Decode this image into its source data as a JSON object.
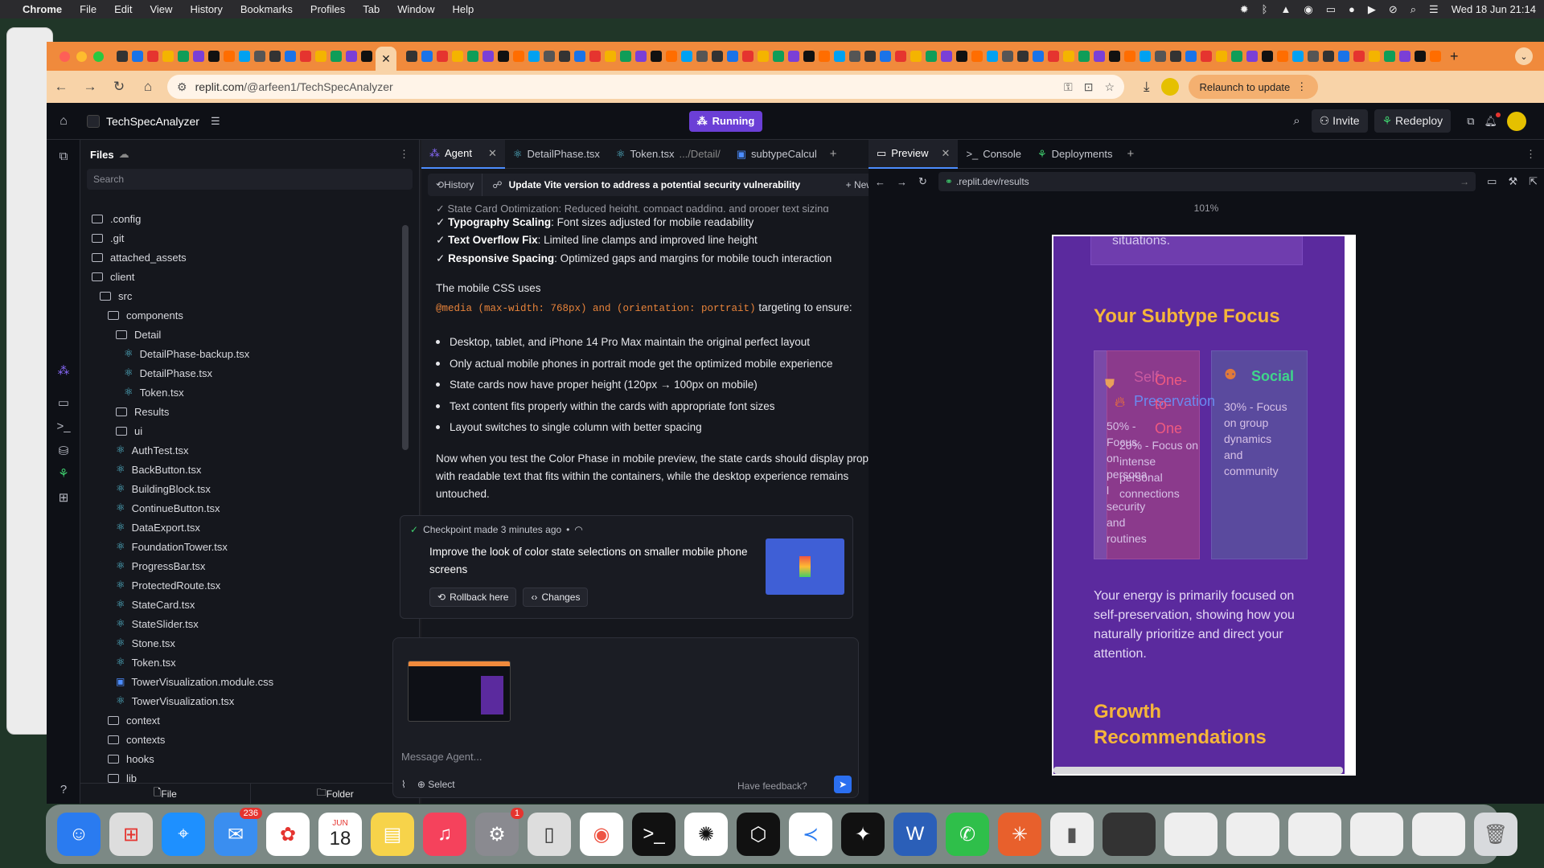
{
  "menubar": {
    "app": "Chrome",
    "items": [
      "File",
      "Edit",
      "View",
      "History",
      "Bookmarks",
      "Profiles",
      "Tab",
      "Window",
      "Help"
    ],
    "datetime": "Wed 18 Jun  21:14"
  },
  "browser": {
    "url_host": "replit.com",
    "url_path": "/@arfeen1/TechSpecAnalyzer",
    "relaunch_label": "Relaunch to update",
    "new_tab": "+"
  },
  "replit": {
    "project_name": "TechSpecAnalyzer",
    "run_status": "Running",
    "invite_label": "Invite",
    "redeploy_label": "Redeploy"
  },
  "files_panel": {
    "title": "Files",
    "search_placeholder": "Search",
    "items": [
      {
        "name": ".config",
        "type": "folder"
      },
      {
        "name": ".git",
        "type": "folder"
      },
      {
        "name": "attached_assets",
        "type": "folder"
      },
      {
        "name": "client",
        "type": "folder"
      },
      {
        "name": "src",
        "type": "folder"
      },
      {
        "name": "components",
        "type": "folder"
      },
      {
        "name": "Detail",
        "type": "folder"
      },
      {
        "name": "DetailPhase-backup.tsx",
        "type": "react"
      },
      {
        "name": "DetailPhase.tsx",
        "type": "react"
      },
      {
        "name": "Token.tsx",
        "type": "react"
      },
      {
        "name": "Results",
        "type": "folder"
      },
      {
        "name": "ui",
        "type": "folder"
      },
      {
        "name": "AuthTest.tsx",
        "type": "react"
      },
      {
        "name": "BackButton.tsx",
        "type": "react"
      },
      {
        "name": "BuildingBlock.tsx",
        "type": "react"
      },
      {
        "name": "ContinueButton.tsx",
        "type": "react"
      },
      {
        "name": "DataExport.tsx",
        "type": "react"
      },
      {
        "name": "FoundationTower.tsx",
        "type": "react"
      },
      {
        "name": "ProgressBar.tsx",
        "type": "react"
      },
      {
        "name": "ProtectedRoute.tsx",
        "type": "react"
      },
      {
        "name": "StateCard.tsx",
        "type": "react"
      },
      {
        "name": "StateSlider.tsx",
        "type": "react"
      },
      {
        "name": "Stone.tsx",
        "type": "react"
      },
      {
        "name": "Token.tsx",
        "type": "react"
      },
      {
        "name": "TowerVisualization.module.css",
        "type": "css"
      },
      {
        "name": "TowerVisualization.tsx",
        "type": "react"
      },
      {
        "name": "context",
        "type": "folder"
      },
      {
        "name": "contexts",
        "type": "folder"
      },
      {
        "name": "hooks",
        "type": "folder"
      },
      {
        "name": "lib",
        "type": "folder"
      }
    ],
    "new_file_label": "File",
    "new_folder_label": "Folder"
  },
  "agent": {
    "tabs": [
      {
        "label": "Agent"
      },
      {
        "label": "DetailPhase.tsx"
      },
      {
        "label": "Token.tsx",
        "extra": ".../Detail/"
      },
      {
        "label": "subtypeCalcul"
      }
    ],
    "history_label": "History",
    "thread_title": "Update Vite version to address a potential security vulnerability",
    "new_chat_label": "New chat",
    "cut_line": "✓ State Card Optimization: Reduced height, compact padding, and proper text sizing",
    "checks": [
      {
        "bold": "Typography Scaling",
        "text": ": Font sizes adjusted for mobile readability"
      },
      {
        "bold": "Text Overflow Fix",
        "text": ": Limited line clamps and improved line height"
      },
      {
        "bold": "Responsive Spacing",
        "text": ": Optimized gaps and margins for mobile touch interaction"
      }
    ],
    "css_intro": "The mobile CSS uses",
    "css_code": "@media (max-width: 768px) and (orientation: portrait)",
    "css_outro": "targeting to ensure:",
    "bullets": [
      "Desktop, tablet, and iPhone 14 Pro Max maintain the original perfect layout",
      "Only actual mobile phones in portrait mode get the optimized mobile experience",
      "State cards now have proper height (120px → 100px on mobile)",
      "Text content fits properly within the cards with appropriate font sizes",
      "Layout switches to single column with better spacing"
    ],
    "summary": "Now when you test the Color Phase in mobile preview, the state cards should display properly with readable text that fits within the containers, while the desktop experience remains untouched.",
    "checkpoint": {
      "meta": "Checkpoint made 3 minutes ago",
      "title": "Improve the look of color state selections on smaller mobile phone screens",
      "rollback_label": "Rollback here",
      "changes_label": "Changes"
    },
    "composer": {
      "placeholder": "Message Agent...",
      "select_label": "Select",
      "feedback_label": "Have feedback?"
    }
  },
  "preview": {
    "tabs": [
      {
        "label": "Preview"
      },
      {
        "label": "Console"
      },
      {
        "label": "Deployments"
      }
    ],
    "url": ".replit.dev/results",
    "zoom": "101%",
    "page": {
      "top_cut": "situations.",
      "section_title": "Your Subtype Focus",
      "card1_title_a": "Self-",
      "card1_title_b": "Preservation",
      "card1_text": "50% - Focus on personal security and routines",
      "card2_title_a": "One-",
      "card2_title_b": "to-",
      "card2_title_c": "One",
      "card2_text": "20% - Focus on intense personal connections",
      "card3_title": "Social",
      "card3_text": "30% - Focus on group dynamics and community",
      "description": "Your energy is primarily focused on self-preservation, showing how you naturally prioritize and direct your attention.",
      "growth_title_a": "Growth",
      "growth_title_b": "Recommendations"
    }
  },
  "dock": {
    "mail_badge": "236",
    "settings_badge": "1",
    "calendar_month": "JUN",
    "calendar_day": "18"
  },
  "colors": {
    "tabstrip": "#f08a3c",
    "toolbar": "#f8d3a8",
    "running": "#6b3fd6",
    "preview_bg": "#5b2a9e",
    "subtype_title": "#f5b53a"
  }
}
